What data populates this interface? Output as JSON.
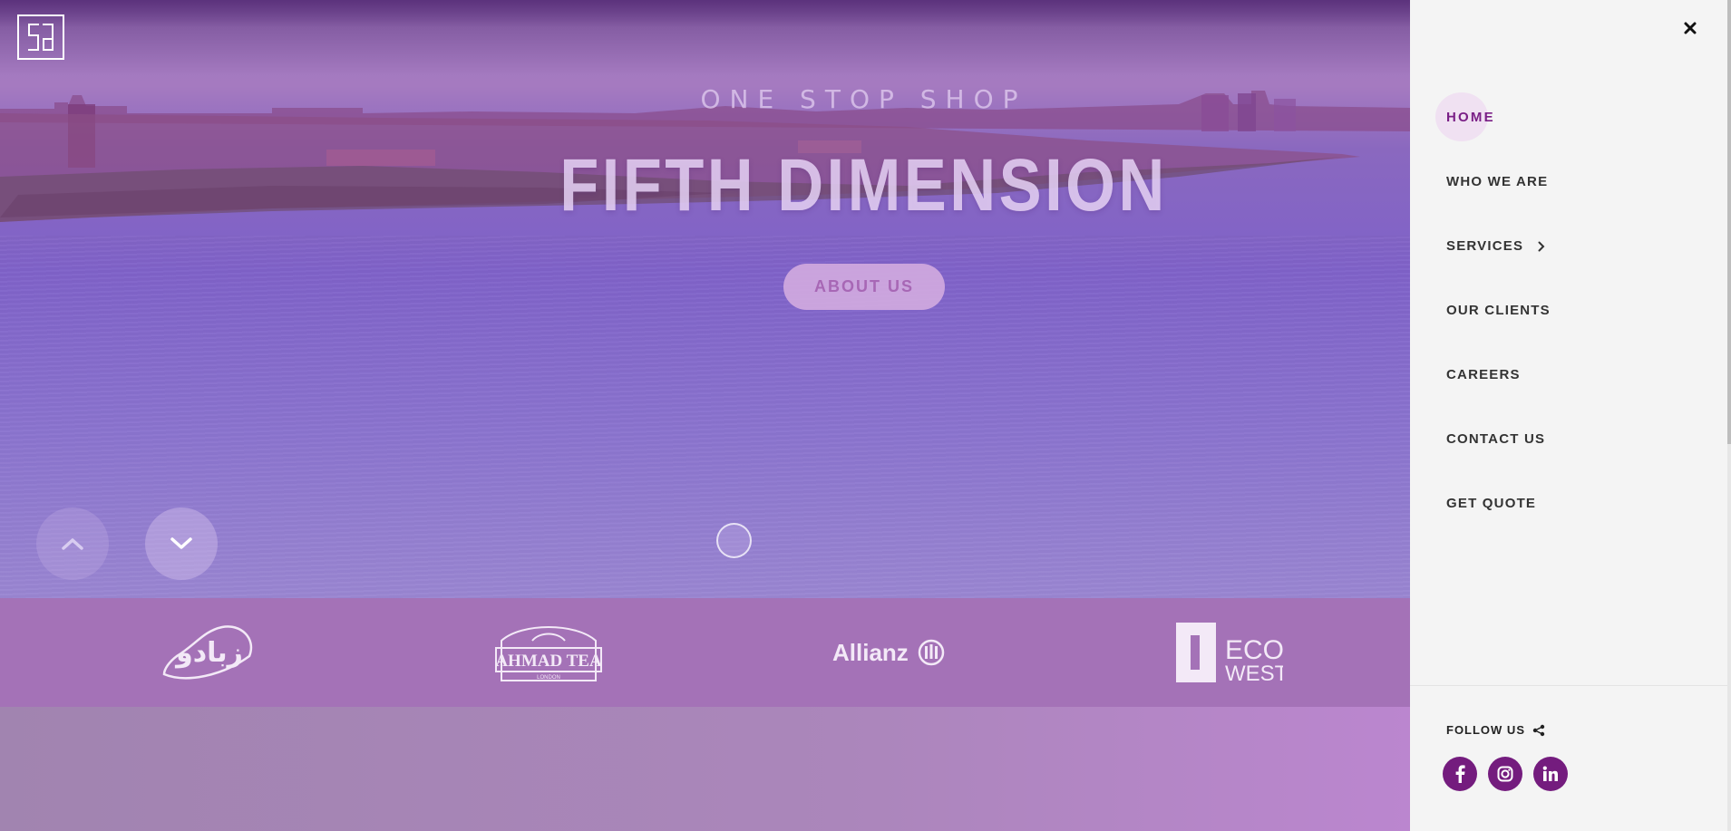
{
  "brand": {
    "logo_icon": "fifth-dimension-logo-icon"
  },
  "hero": {
    "eyebrow": "ONE STOP SHOP",
    "title": "FIFTH DIMENSION",
    "cta_label": "ABOUT US",
    "up_icon": "chevron-up-icon",
    "down_icon": "chevron-down-icon"
  },
  "clients": [
    {
      "name": "Zabado",
      "text": "زبادو"
    },
    {
      "name": "Ahmad Tea",
      "text": "AHMAD TEA",
      "sub": "LONDON"
    },
    {
      "name": "Allianz",
      "text": "Allianz"
    },
    {
      "name": "Eco West",
      "text_line1": "ECO",
      "text_line2": "WEST"
    }
  ],
  "menu": {
    "close_icon": "close-icon",
    "items": [
      {
        "label": "HOME",
        "active": true
      },
      {
        "label": "WHO WE ARE"
      },
      {
        "label": "SERVICES",
        "has_submenu": true
      },
      {
        "label": "OUR CLIENTS"
      },
      {
        "label": "CAREERS"
      },
      {
        "label": "CONTACT US"
      },
      {
        "label": "GET QUOTE"
      }
    ],
    "follow_label": "FOLLOW US",
    "social": [
      "facebook-icon",
      "instagram-icon",
      "linkedin-icon"
    ]
  },
  "colors": {
    "accent": "#741c7e",
    "active_text": "#7a1f86",
    "hero_overlay": "#8b6cc9",
    "clients_strip": "#a472b7",
    "side_bg": "#f4f4f4"
  }
}
